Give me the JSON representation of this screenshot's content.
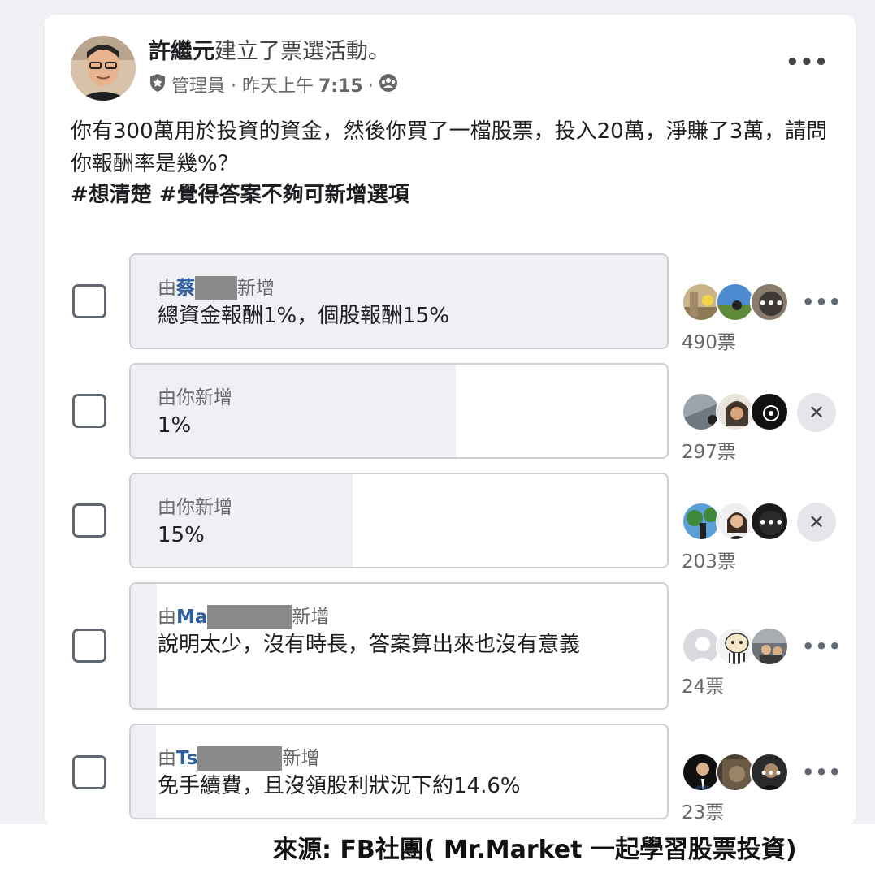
{
  "post": {
    "author": "許繼元",
    "action": "建立了票選活動。",
    "role": "管理員 · 昨天上午",
    "time": "7:15",
    "separator": "·",
    "question": "你有300萬用於投資的資金，然後你買了一檔股票，投入20萬，淨賺了3萬，請問你報酬率是幾%？",
    "hashtags": "#想清楚 #覺得答案不夠可新增選項",
    "more_icon": "more-horizontal-icon",
    "badge_icon": "admin-shield-icon",
    "audience_icon": "group-audience-icon"
  },
  "options": [
    {
      "adder_prefix": "由",
      "adder_name": "蔡",
      "adder_suffix": "新增",
      "label": "總資金報酬1%，個股報酬15%",
      "votes": "490票",
      "vote_fraction": 1.0,
      "action": "more",
      "action_symbol": "•••"
    },
    {
      "adder_prefix": "由你新增",
      "adder_name": "",
      "adder_suffix": "",
      "label": "1%",
      "votes": "297票",
      "vote_fraction": 0.606,
      "action": "remove",
      "action_symbol": "✕"
    },
    {
      "adder_prefix": "由你新增",
      "adder_name": "",
      "adder_suffix": "",
      "label": "15%",
      "votes": "203票",
      "vote_fraction": 0.414,
      "action": "remove",
      "action_symbol": "✕"
    },
    {
      "adder_prefix": "由",
      "adder_name": "Ma",
      "adder_suffix": "新增",
      "label": "說明太少，沒有時長，答案算出來也沒有意義",
      "votes": "24票",
      "vote_fraction": 0.049,
      "action": "more",
      "action_symbol": "•••"
    },
    {
      "adder_prefix": "由",
      "adder_name": "Ts",
      "adder_suffix": "新增",
      "label": "免手續費，且沒領股利狀況下約14.6%",
      "votes": "23票",
      "vote_fraction": 0.047,
      "action": "more",
      "action_symbol": "•••"
    }
  ],
  "source": "來源: FB社團( Mr.Market 一起學習股票投資)",
  "colors": {
    "link": "#2f5f9e",
    "fill": "#eef0f3",
    "border": "#ccd0d5"
  }
}
